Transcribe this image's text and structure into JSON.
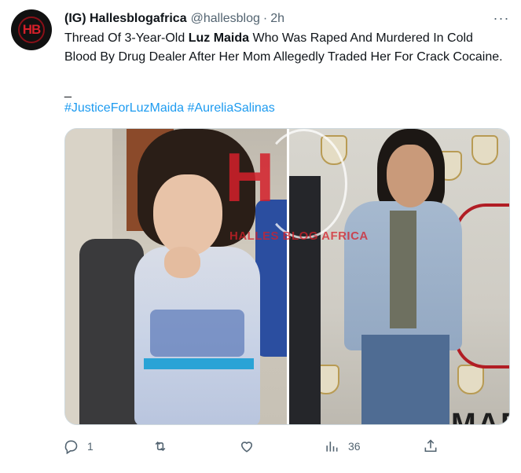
{
  "tweet": {
    "author_name": "(IG) Hallesblogafrica",
    "handle": "@hallesblog",
    "separator": "·",
    "time": "2h",
    "more_glyph": "···",
    "text_before": "Thread Of 3-Year-Old ",
    "text_bold": "Luz Maida",
    "text_after": " Who Was Raped And Murdered In Cold Blood By Drug Dealer After Her Mom Allegedly Traded Her For Crack Cocaine.",
    "dash": "_",
    "hashtags": [
      "#JusticeForLuzMaida",
      "#AureliaSalinas"
    ]
  },
  "avatar": {
    "mark": "HB"
  },
  "media": {
    "watermark_letter": "H",
    "watermark_text": "HALLES BLOG AFRICA",
    "poster_text": "MAR AY"
  },
  "actions": {
    "reply_count": "1",
    "retweet_count": "",
    "like_count": "",
    "views_count": "36"
  },
  "colors": {
    "link": "#1d9bf0",
    "secondary_text": "#536471",
    "watermark_red": "#d4202a"
  }
}
